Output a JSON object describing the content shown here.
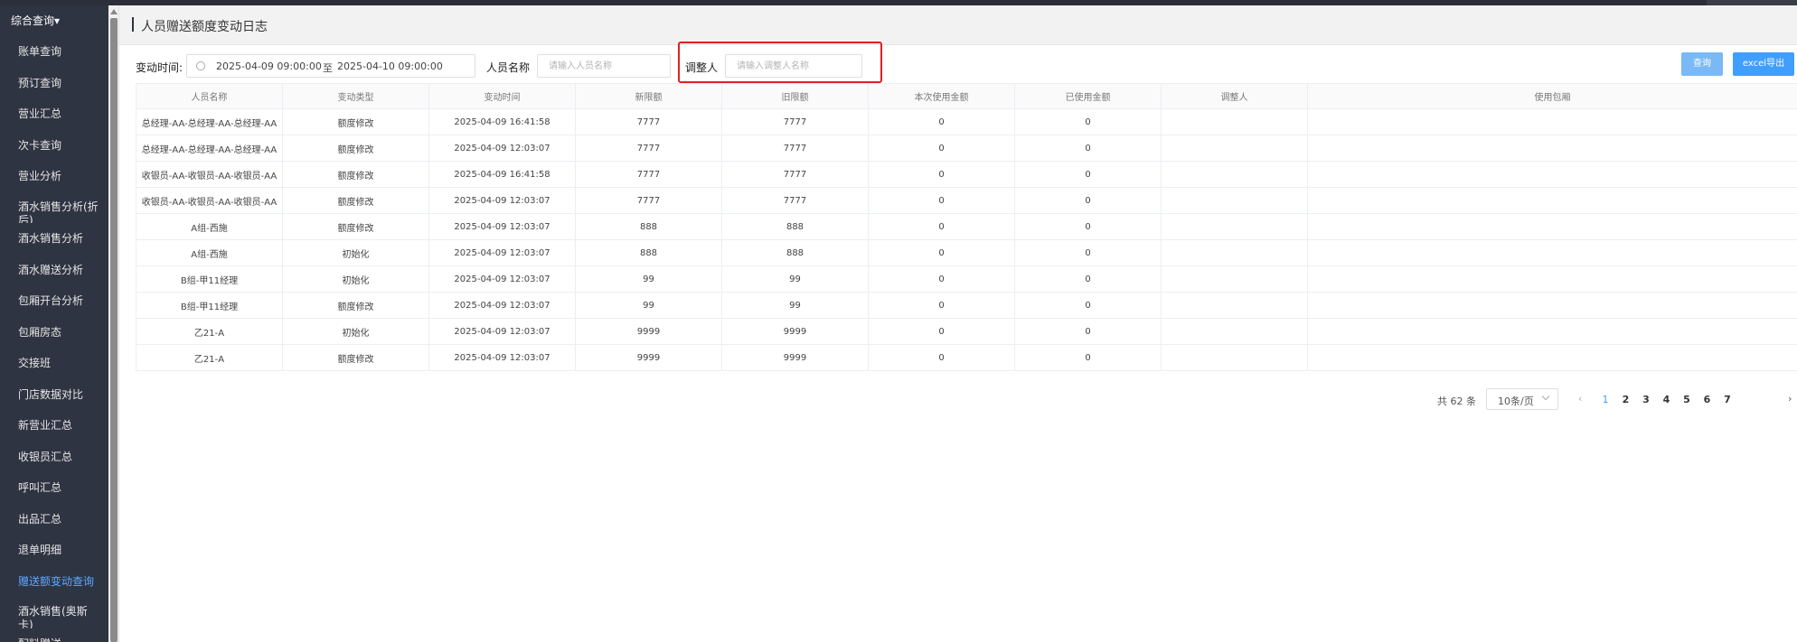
{
  "sidebar": {
    "header": "综合查询▾",
    "items": [
      {
        "label": "账单查询"
      },
      {
        "label": "预订查询"
      },
      {
        "label": "营业汇总"
      },
      {
        "label": "次卡查询"
      },
      {
        "label": "营业分析"
      },
      {
        "label": "酒水销售分析(折后)"
      },
      {
        "label": "酒水销售分析"
      },
      {
        "label": "酒水赠送分析"
      },
      {
        "label": "包厢开台分析"
      },
      {
        "label": "包厢房态"
      },
      {
        "label": "交接班"
      },
      {
        "label": "门店数据对比"
      },
      {
        "label": "新营业汇总"
      },
      {
        "label": "收银员汇总"
      },
      {
        "label": "呼叫汇总"
      },
      {
        "label": "出品汇总"
      },
      {
        "label": "退单明细"
      },
      {
        "label": "赠送额变动查询",
        "active": true
      },
      {
        "label": "酒水销售(奥斯卡)"
      },
      {
        "label": "配料赠送"
      }
    ]
  },
  "page": {
    "title": "人员赠送额度变动日志"
  },
  "filters": {
    "time_label": "变动时间:",
    "start": "2025-04-09 09:00:00",
    "range_sep": "至",
    "end": "2025-04-10 09:00:00",
    "name_label": "人员名称",
    "name_placeholder": "请输入人员名称",
    "adjuster_label": "调整人",
    "adjuster_placeholder": "请输入调整人名称"
  },
  "buttons": {
    "query": "查询",
    "excel": "excel导出"
  },
  "table": {
    "headers": [
      "人员名称",
      "变动类型",
      "变动时间",
      "新限额",
      "旧限额",
      "本次使用金额",
      "已使用金额",
      "调整人",
      "使用包厢"
    ],
    "rows": [
      [
        "总经理-AA-总经理-AA-总经理-AA",
        "额度修改",
        "2025-04-09 16:41:58",
        "7777",
        "7777",
        "0",
        "0",
        "",
        ""
      ],
      [
        "总经理-AA-总经理-AA-总经理-AA",
        "额度修改",
        "2025-04-09 12:03:07",
        "7777",
        "7777",
        "0",
        "0",
        "",
        ""
      ],
      [
        "收银员-AA-收银员-AA-收银员-AA",
        "额度修改",
        "2025-04-09 16:41:58",
        "7777",
        "7777",
        "0",
        "0",
        "",
        ""
      ],
      [
        "收银员-AA-收银员-AA-收银员-AA",
        "额度修改",
        "2025-04-09 12:03:07",
        "7777",
        "7777",
        "0",
        "0",
        "",
        ""
      ],
      [
        "A组-西施",
        "额度修改",
        "2025-04-09 12:03:07",
        "888",
        "888",
        "0",
        "0",
        "",
        ""
      ],
      [
        "A组-西施",
        "初始化",
        "2025-04-09 12:03:07",
        "888",
        "888",
        "0",
        "0",
        "",
        ""
      ],
      [
        "B组-甲11经理",
        "初始化",
        "2025-04-09 12:03:07",
        "99",
        "99",
        "0",
        "0",
        "",
        ""
      ],
      [
        "B组-甲11经理",
        "额度修改",
        "2025-04-09 12:03:07",
        "99",
        "99",
        "0",
        "0",
        "",
        ""
      ],
      [
        "乙21-A",
        "初始化",
        "2025-04-09 12:03:07",
        "9999",
        "9999",
        "0",
        "0",
        "",
        ""
      ],
      [
        "乙21-A",
        "额度修改",
        "2025-04-09 12:03:07",
        "9999",
        "9999",
        "0",
        "0",
        "",
        ""
      ]
    ]
  },
  "pagination": {
    "total": "共 62 条",
    "page_size": "10条/页",
    "prev": "‹",
    "pages": [
      "1",
      "2",
      "3",
      "4",
      "5",
      "6",
      "7"
    ],
    "current": "1",
    "next": "›"
  }
}
